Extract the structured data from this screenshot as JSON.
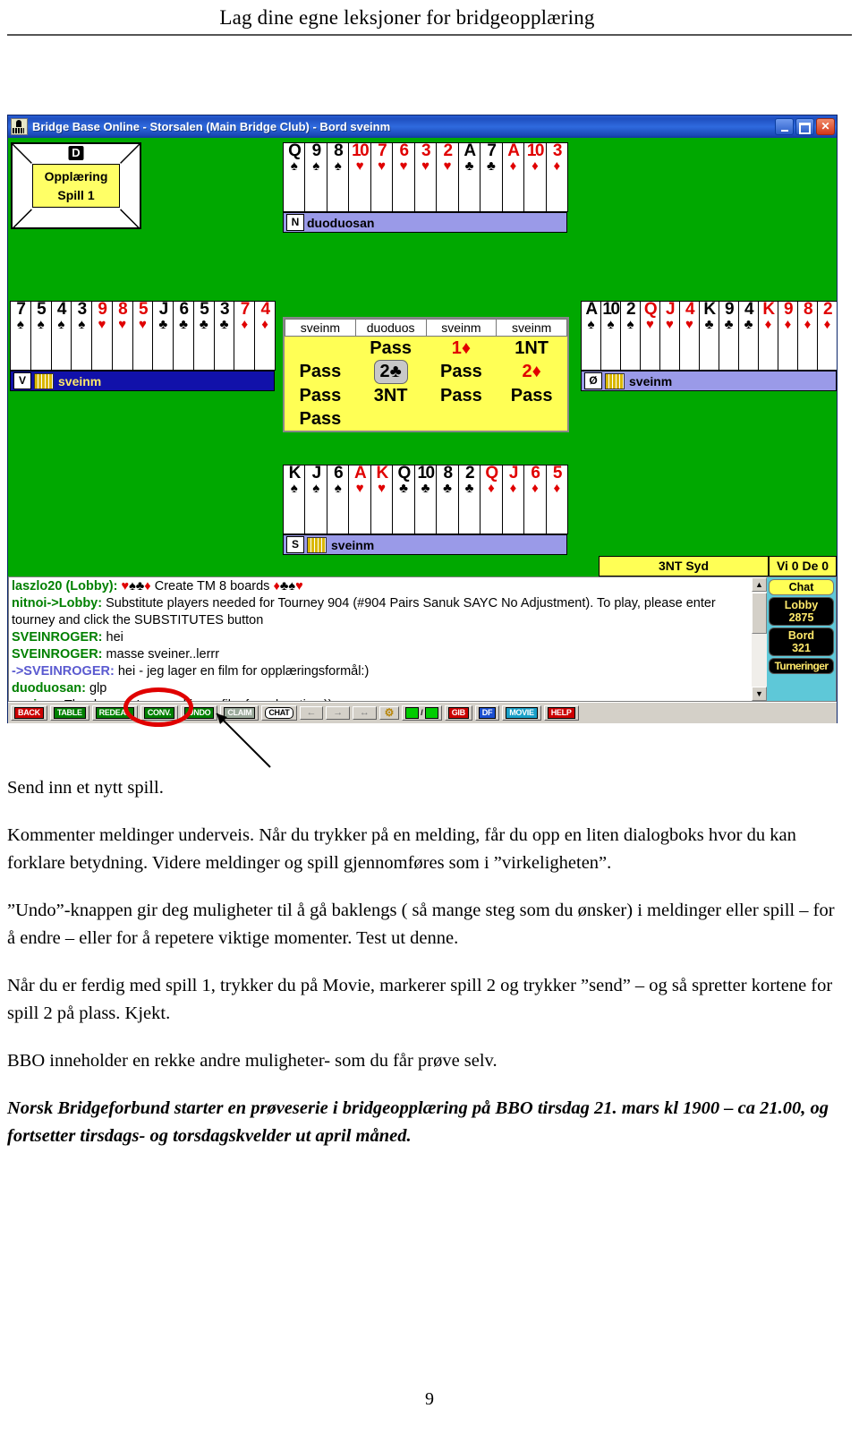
{
  "header": {
    "title": "Lag dine egne leksjoner for bridgeopplæring"
  },
  "screenshot": {
    "window_title": "Bridge Base Online - Storsalen (Main Bridge Club) - Bord sveinm",
    "window_buttons": {
      "minimize": "_",
      "maximize": "□",
      "close": "✕"
    },
    "board_marker": {
      "dealer": "D",
      "line1": "Opplæring",
      "line2": "Spill 1"
    },
    "hands": {
      "north": {
        "direction": "N",
        "player": "duoduosan",
        "cards": [
          {
            "rank": "Q",
            "suit": "♠",
            "color": "black"
          },
          {
            "rank": "9",
            "suit": "♠",
            "color": "black"
          },
          {
            "rank": "8",
            "suit": "♠",
            "color": "black"
          },
          {
            "rank": "10",
            "suit": "♥",
            "color": "red"
          },
          {
            "rank": "7",
            "suit": "♥",
            "color": "red"
          },
          {
            "rank": "6",
            "suit": "♥",
            "color": "red"
          },
          {
            "rank": "3",
            "suit": "♥",
            "color": "red"
          },
          {
            "rank": "2",
            "suit": "♥",
            "color": "red"
          },
          {
            "rank": "A",
            "suit": "♣",
            "color": "black"
          },
          {
            "rank": "7",
            "suit": "♣",
            "color": "black"
          },
          {
            "rank": "A",
            "suit": "♦",
            "color": "red"
          },
          {
            "rank": "10",
            "suit": "♦",
            "color": "red"
          },
          {
            "rank": "3",
            "suit": "♦",
            "color": "red"
          }
        ]
      },
      "west": {
        "direction": "V",
        "player": "sveinm",
        "cards": [
          {
            "rank": "7",
            "suit": "♠",
            "color": "black"
          },
          {
            "rank": "5",
            "suit": "♠",
            "color": "black"
          },
          {
            "rank": "4",
            "suit": "♠",
            "color": "black"
          },
          {
            "rank": "3",
            "suit": "♠",
            "color": "black"
          },
          {
            "rank": "9",
            "suit": "♥",
            "color": "red"
          },
          {
            "rank": "8",
            "suit": "♥",
            "color": "red"
          },
          {
            "rank": "5",
            "suit": "♥",
            "color": "red"
          },
          {
            "rank": "J",
            "suit": "♣",
            "color": "black"
          },
          {
            "rank": "6",
            "suit": "♣",
            "color": "black"
          },
          {
            "rank": "5",
            "suit": "♣",
            "color": "black"
          },
          {
            "rank": "3",
            "suit": "♣",
            "color": "black"
          },
          {
            "rank": "7",
            "suit": "♦",
            "color": "red"
          },
          {
            "rank": "4",
            "suit": "♦",
            "color": "red"
          }
        ]
      },
      "east": {
        "direction": "Ø",
        "player": "sveinm",
        "cards": [
          {
            "rank": "A",
            "suit": "♠",
            "color": "black"
          },
          {
            "rank": "10",
            "suit": "♠",
            "color": "black"
          },
          {
            "rank": "2",
            "suit": "♠",
            "color": "black"
          },
          {
            "rank": "Q",
            "suit": "♥",
            "color": "red"
          },
          {
            "rank": "J",
            "suit": "♥",
            "color": "red"
          },
          {
            "rank": "4",
            "suit": "♥",
            "color": "red"
          },
          {
            "rank": "K",
            "suit": "♣",
            "color": "black"
          },
          {
            "rank": "9",
            "suit": "♣",
            "color": "black"
          },
          {
            "rank": "4",
            "suit": "♣",
            "color": "black"
          },
          {
            "rank": "K",
            "suit": "♦",
            "color": "red"
          },
          {
            "rank": "9",
            "suit": "♦",
            "color": "red"
          },
          {
            "rank": "8",
            "suit": "♦",
            "color": "red"
          },
          {
            "rank": "2",
            "suit": "♦",
            "color": "red"
          }
        ]
      },
      "south": {
        "direction": "S",
        "player": "sveinm",
        "cards": [
          {
            "rank": "K",
            "suit": "♠",
            "color": "black"
          },
          {
            "rank": "J",
            "suit": "♠",
            "color": "black"
          },
          {
            "rank": "6",
            "suit": "♠",
            "color": "black"
          },
          {
            "rank": "A",
            "suit": "♥",
            "color": "red"
          },
          {
            "rank": "K",
            "suit": "♥",
            "color": "red"
          },
          {
            "rank": "Q",
            "suit": "♣",
            "color": "black"
          },
          {
            "rank": "10",
            "suit": "♣",
            "color": "black"
          },
          {
            "rank": "8",
            "suit": "♣",
            "color": "black"
          },
          {
            "rank": "2",
            "suit": "♣",
            "color": "black"
          },
          {
            "rank": "Q",
            "suit": "♦",
            "color": "red"
          },
          {
            "rank": "J",
            "suit": "♦",
            "color": "red"
          },
          {
            "rank": "6",
            "suit": "♦",
            "color": "red"
          },
          {
            "rank": "5",
            "suit": "♦",
            "color": "red"
          }
        ]
      }
    },
    "auction": {
      "headers": [
        "sveinm",
        "duoduos",
        "sveinm",
        "sveinm"
      ],
      "rows": [
        [
          {
            "text": "",
            "color": "black",
            "selected": false
          },
          {
            "text": "Pass",
            "color": "black",
            "selected": false
          },
          {
            "text": "1♦",
            "color": "red",
            "selected": false
          },
          {
            "text": "1NT",
            "color": "black",
            "selected": false
          }
        ],
        [
          {
            "text": "Pass",
            "color": "black",
            "selected": false
          },
          {
            "text": "2♣",
            "color": "black",
            "selected": true
          },
          {
            "text": "Pass",
            "color": "black",
            "selected": false
          },
          {
            "text": "2♦",
            "color": "red",
            "selected": false
          }
        ],
        [
          {
            "text": "Pass",
            "color": "black",
            "selected": false
          },
          {
            "text": "3NT",
            "color": "black",
            "selected": false
          },
          {
            "text": "Pass",
            "color": "black",
            "selected": false
          },
          {
            "text": "Pass",
            "color": "black",
            "selected": false
          }
        ],
        [
          {
            "text": "Pass",
            "color": "black",
            "selected": false
          },
          {
            "text": "",
            "color": "black",
            "selected": false
          },
          {
            "text": "",
            "color": "black",
            "selected": false
          },
          {
            "text": "",
            "color": "black",
            "selected": false
          }
        ]
      ]
    },
    "contract": "3NT Syd",
    "tricks": "Vi 0 De 0",
    "chat": [
      {
        "who": "laszlo20 (Lobby):",
        "who_color": "green",
        "pre_symbols": [
          "♥",
          "♠",
          "♣",
          "♦"
        ],
        "text": "Create TM 8 boards",
        "post_symbols": [
          "♦",
          "♣",
          "♠",
          "♥"
        ]
      },
      {
        "who": "nitnoi->Lobby:",
        "who_color": "green",
        "text": "Substitute players needed for Tourney 904 (#904 Pairs Sanuk SAYC  No Adjustment). To play, please enter tourney and click the SUBSTITUTES button"
      },
      {
        "who": "SVEINROGER:",
        "who_color": "green",
        "text": "hei"
      },
      {
        "who": "SVEINROGER:",
        "who_color": "green",
        "text": "masse sveiner..lerrr"
      },
      {
        "who": "->SVEINROGER:",
        "who_color": "blueish",
        "text": "hei - jeg lager en film for opplæringsformål:)"
      },
      {
        "who": "duoduosan:",
        "who_color": "green",
        "text": "glp"
      },
      {
        "who": "sveinm:",
        "who_color": "green",
        "text": "Thank you - I am making a film for education:))"
      }
    ],
    "side_buttons": [
      {
        "label": "Chat",
        "style": "chat"
      },
      {
        "label": "Lobby\n2875",
        "style": "dark"
      },
      {
        "label": "Bord\n321",
        "style": "dark"
      },
      {
        "label": "Turneringer",
        "style": "dark-wide"
      }
    ],
    "toolbar": [
      {
        "label": "BACK",
        "style": "red"
      },
      {
        "label": "TABLE",
        "style": "green"
      },
      {
        "label": "REDEAL",
        "style": "green"
      },
      {
        "label": "CONV.",
        "style": "green"
      },
      {
        "label": "UNDO",
        "style": "green"
      },
      {
        "label": "CLAIM",
        "style": "gray"
      },
      {
        "label": "CHAT",
        "style": "white"
      },
      {
        "label": "←",
        "style": "arrow"
      },
      {
        "label": "→",
        "style": "arrow"
      },
      {
        "label": "↔",
        "style": "arrow"
      },
      {
        "label": "⚙",
        "style": "gear"
      },
      {
        "label": "/",
        "style": "swatch"
      },
      {
        "label": "GIB",
        "style": "darkred"
      },
      {
        "label": "DF",
        "style": "blue"
      },
      {
        "label": "MOVIE",
        "style": "cyan"
      },
      {
        "label": "HELP",
        "style": "red"
      }
    ]
  },
  "body": {
    "p1": "Send inn et nytt spill.",
    "p2": "Kommenter meldinger underveis. Når du trykker på en melding, får du opp en liten dialogboks hvor du kan forklare betydning.  Videre meldinger og spill gjennomføres som i ”virkeligheten”.",
    "p3": "”Undo”-knappen gir deg muligheter til å gå baklengs ( så mange steg som du ønsker)  i meldinger eller spill – for å endre – eller for å repetere viktige momenter. Test ut denne.",
    "p4": "Når du er ferdig med spill 1, trykker du på Movie, markerer spill 2 og trykker ”send” – og så spretter kortene for spill 2 på plass. Kjekt.",
    "p5": "BBO inneholder en rekke andre muligheter- som du får prøve selv.",
    "p6": "Norsk Bridgeforbund starter en prøveserie i bridgeopplæring på BBO tirsdag 21. mars kl 1900 – ca 21.00, og fortsetter tirsdags- og torsdagskvelder ut april måned."
  },
  "page_number": "9"
}
